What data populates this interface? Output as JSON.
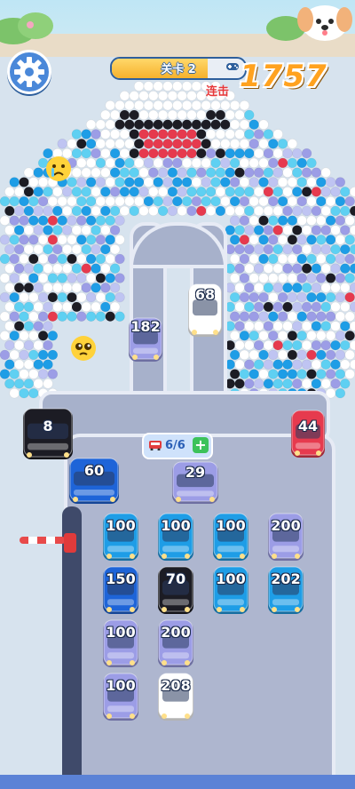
{
  "hud": {
    "level_label": "关卡 2",
    "level_progress": 0.72,
    "combo_label": "连击",
    "score": "1757"
  },
  "capacity": {
    "label": "6/6",
    "add": "+"
  },
  "colors": {
    "ball_palette": [
      "#ffffff",
      "#1e9de6",
      "#5fd0f2",
      "#9c9de6",
      "#bfc4f2",
      "#1c1c24",
      "#e63a4e"
    ],
    "level_fill": "#f6b12c",
    "score": "#ffa21f",
    "track": "#a7b1cb"
  },
  "icons": [
    "gear-icon",
    "gamepad-icon",
    "bus-icon",
    "plus-icon",
    "crying-emoji-icon",
    "pleading-emoji-icon",
    "puppy-icon"
  ],
  "cars": [
    {
      "id": "182",
      "label": "182",
      "color": "#9c9de6"
    },
    {
      "id": "68",
      "label": "68",
      "color": "#ffffff"
    },
    {
      "id": "8",
      "label": "8",
      "color": "#1c1c24"
    },
    {
      "id": "44",
      "label": "44",
      "color": "#e63a4e"
    },
    {
      "id": "60",
      "label": "60",
      "color": "#1e64d8"
    },
    {
      "id": "29",
      "label": "29",
      "color": "#9c9de6"
    },
    {
      "id": "r1c1",
      "label": "100",
      "color": "#1e9de6"
    },
    {
      "id": "r1c2",
      "label": "100",
      "color": "#1e9de6"
    },
    {
      "id": "r1c3",
      "label": "100",
      "color": "#1e9de6"
    },
    {
      "id": "r1c4",
      "label": "200",
      "color": "#9c9de6"
    },
    {
      "id": "r2c1",
      "label": "150",
      "color": "#1e64d8"
    },
    {
      "id": "r2c2",
      "label": "70",
      "color": "#1c1c24"
    },
    {
      "id": "r2c3",
      "label": "100",
      "color": "#1e9de6"
    },
    {
      "id": "r2c4",
      "label": "202",
      "color": "#1e9de6"
    },
    {
      "id": "r3c1",
      "label": "100",
      "color": "#9c9de6"
    },
    {
      "id": "r3c2",
      "label": "200",
      "color": "#9c9de6"
    },
    {
      "id": "r4c1",
      "label": "100",
      "color": "#9c9de6"
    },
    {
      "id": "r4c2",
      "label": "208",
      "color": "#ffffff"
    }
  ]
}
